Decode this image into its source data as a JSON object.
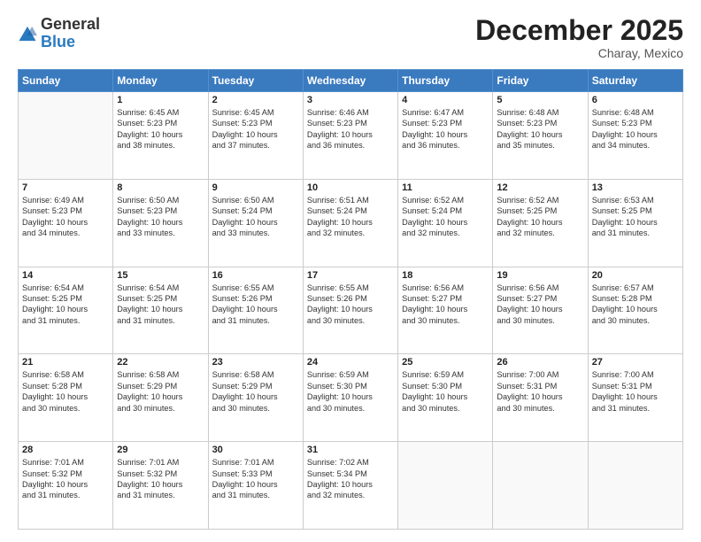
{
  "header": {
    "logo_general": "General",
    "logo_blue": "Blue",
    "month_title": "December 2025",
    "location": "Charay, Mexico"
  },
  "days_of_week": [
    "Sunday",
    "Monday",
    "Tuesday",
    "Wednesday",
    "Thursday",
    "Friday",
    "Saturday"
  ],
  "weeks": [
    [
      {
        "day": "",
        "info": ""
      },
      {
        "day": "1",
        "info": "Sunrise: 6:45 AM\nSunset: 5:23 PM\nDaylight: 10 hours\nand 38 minutes."
      },
      {
        "day": "2",
        "info": "Sunrise: 6:45 AM\nSunset: 5:23 PM\nDaylight: 10 hours\nand 37 minutes."
      },
      {
        "day": "3",
        "info": "Sunrise: 6:46 AM\nSunset: 5:23 PM\nDaylight: 10 hours\nand 36 minutes."
      },
      {
        "day": "4",
        "info": "Sunrise: 6:47 AM\nSunset: 5:23 PM\nDaylight: 10 hours\nand 36 minutes."
      },
      {
        "day": "5",
        "info": "Sunrise: 6:48 AM\nSunset: 5:23 PM\nDaylight: 10 hours\nand 35 minutes."
      },
      {
        "day": "6",
        "info": "Sunrise: 6:48 AM\nSunset: 5:23 PM\nDaylight: 10 hours\nand 34 minutes."
      }
    ],
    [
      {
        "day": "7",
        "info": "Sunrise: 6:49 AM\nSunset: 5:23 PM\nDaylight: 10 hours\nand 34 minutes."
      },
      {
        "day": "8",
        "info": "Sunrise: 6:50 AM\nSunset: 5:23 PM\nDaylight: 10 hours\nand 33 minutes."
      },
      {
        "day": "9",
        "info": "Sunrise: 6:50 AM\nSunset: 5:24 PM\nDaylight: 10 hours\nand 33 minutes."
      },
      {
        "day": "10",
        "info": "Sunrise: 6:51 AM\nSunset: 5:24 PM\nDaylight: 10 hours\nand 32 minutes."
      },
      {
        "day": "11",
        "info": "Sunrise: 6:52 AM\nSunset: 5:24 PM\nDaylight: 10 hours\nand 32 minutes."
      },
      {
        "day": "12",
        "info": "Sunrise: 6:52 AM\nSunset: 5:25 PM\nDaylight: 10 hours\nand 32 minutes."
      },
      {
        "day": "13",
        "info": "Sunrise: 6:53 AM\nSunset: 5:25 PM\nDaylight: 10 hours\nand 31 minutes."
      }
    ],
    [
      {
        "day": "14",
        "info": "Sunrise: 6:54 AM\nSunset: 5:25 PM\nDaylight: 10 hours\nand 31 minutes."
      },
      {
        "day": "15",
        "info": "Sunrise: 6:54 AM\nSunset: 5:25 PM\nDaylight: 10 hours\nand 31 minutes."
      },
      {
        "day": "16",
        "info": "Sunrise: 6:55 AM\nSunset: 5:26 PM\nDaylight: 10 hours\nand 31 minutes."
      },
      {
        "day": "17",
        "info": "Sunrise: 6:55 AM\nSunset: 5:26 PM\nDaylight: 10 hours\nand 30 minutes."
      },
      {
        "day": "18",
        "info": "Sunrise: 6:56 AM\nSunset: 5:27 PM\nDaylight: 10 hours\nand 30 minutes."
      },
      {
        "day": "19",
        "info": "Sunrise: 6:56 AM\nSunset: 5:27 PM\nDaylight: 10 hours\nand 30 minutes."
      },
      {
        "day": "20",
        "info": "Sunrise: 6:57 AM\nSunset: 5:28 PM\nDaylight: 10 hours\nand 30 minutes."
      }
    ],
    [
      {
        "day": "21",
        "info": "Sunrise: 6:58 AM\nSunset: 5:28 PM\nDaylight: 10 hours\nand 30 minutes."
      },
      {
        "day": "22",
        "info": "Sunrise: 6:58 AM\nSunset: 5:29 PM\nDaylight: 10 hours\nand 30 minutes."
      },
      {
        "day": "23",
        "info": "Sunrise: 6:58 AM\nSunset: 5:29 PM\nDaylight: 10 hours\nand 30 minutes."
      },
      {
        "day": "24",
        "info": "Sunrise: 6:59 AM\nSunset: 5:30 PM\nDaylight: 10 hours\nand 30 minutes."
      },
      {
        "day": "25",
        "info": "Sunrise: 6:59 AM\nSunset: 5:30 PM\nDaylight: 10 hours\nand 30 minutes."
      },
      {
        "day": "26",
        "info": "Sunrise: 7:00 AM\nSunset: 5:31 PM\nDaylight: 10 hours\nand 30 minutes."
      },
      {
        "day": "27",
        "info": "Sunrise: 7:00 AM\nSunset: 5:31 PM\nDaylight: 10 hours\nand 31 minutes."
      }
    ],
    [
      {
        "day": "28",
        "info": "Sunrise: 7:01 AM\nSunset: 5:32 PM\nDaylight: 10 hours\nand 31 minutes."
      },
      {
        "day": "29",
        "info": "Sunrise: 7:01 AM\nSunset: 5:32 PM\nDaylight: 10 hours\nand 31 minutes."
      },
      {
        "day": "30",
        "info": "Sunrise: 7:01 AM\nSunset: 5:33 PM\nDaylight: 10 hours\nand 31 minutes."
      },
      {
        "day": "31",
        "info": "Sunrise: 7:02 AM\nSunset: 5:34 PM\nDaylight: 10 hours\nand 32 minutes."
      },
      {
        "day": "",
        "info": ""
      },
      {
        "day": "",
        "info": ""
      },
      {
        "day": "",
        "info": ""
      }
    ]
  ]
}
